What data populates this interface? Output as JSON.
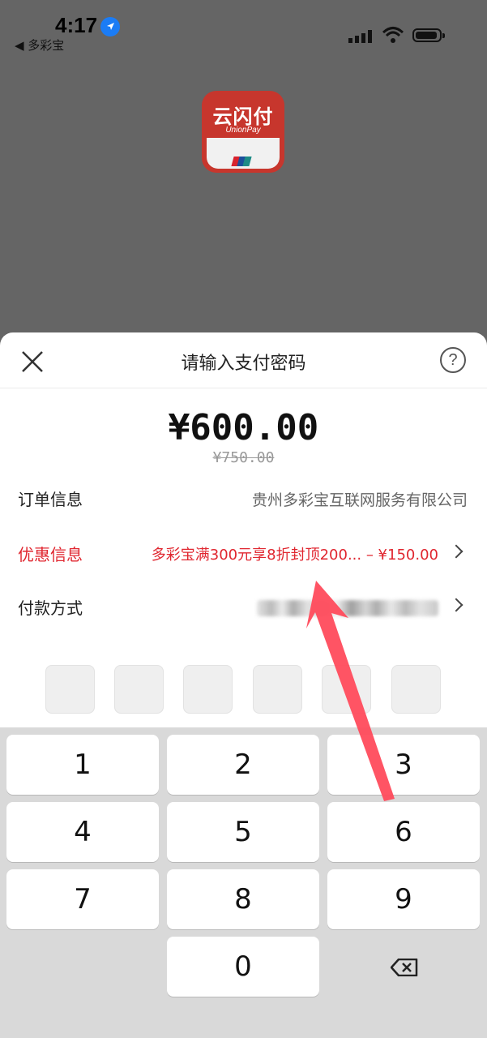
{
  "status_bar": {
    "time": "4:17",
    "back_label": "◀ 多彩宝"
  },
  "logo": {
    "main": "云闪付",
    "sub": "UnionPay"
  },
  "sheet": {
    "title": "请输入支付密码",
    "help_label": "?",
    "amount": "¥600.00",
    "original_amount": "¥750.00",
    "rows": [
      {
        "label": "订单信息",
        "value": "贵州多彩宝互联网服务有限公司"
      },
      {
        "label": "优惠信息",
        "value": "多彩宝满300元享8折封顶200... – ¥150.00"
      },
      {
        "label": "付款方式",
        "value": ""
      }
    ]
  },
  "keypad": {
    "keys": [
      "1",
      "2",
      "3",
      "4",
      "5",
      "6",
      "7",
      "8",
      "9",
      "0"
    ]
  },
  "colors": {
    "accent_red": "#e0262f",
    "unionpay_red": "#c7362d",
    "overlay": "#656565"
  }
}
